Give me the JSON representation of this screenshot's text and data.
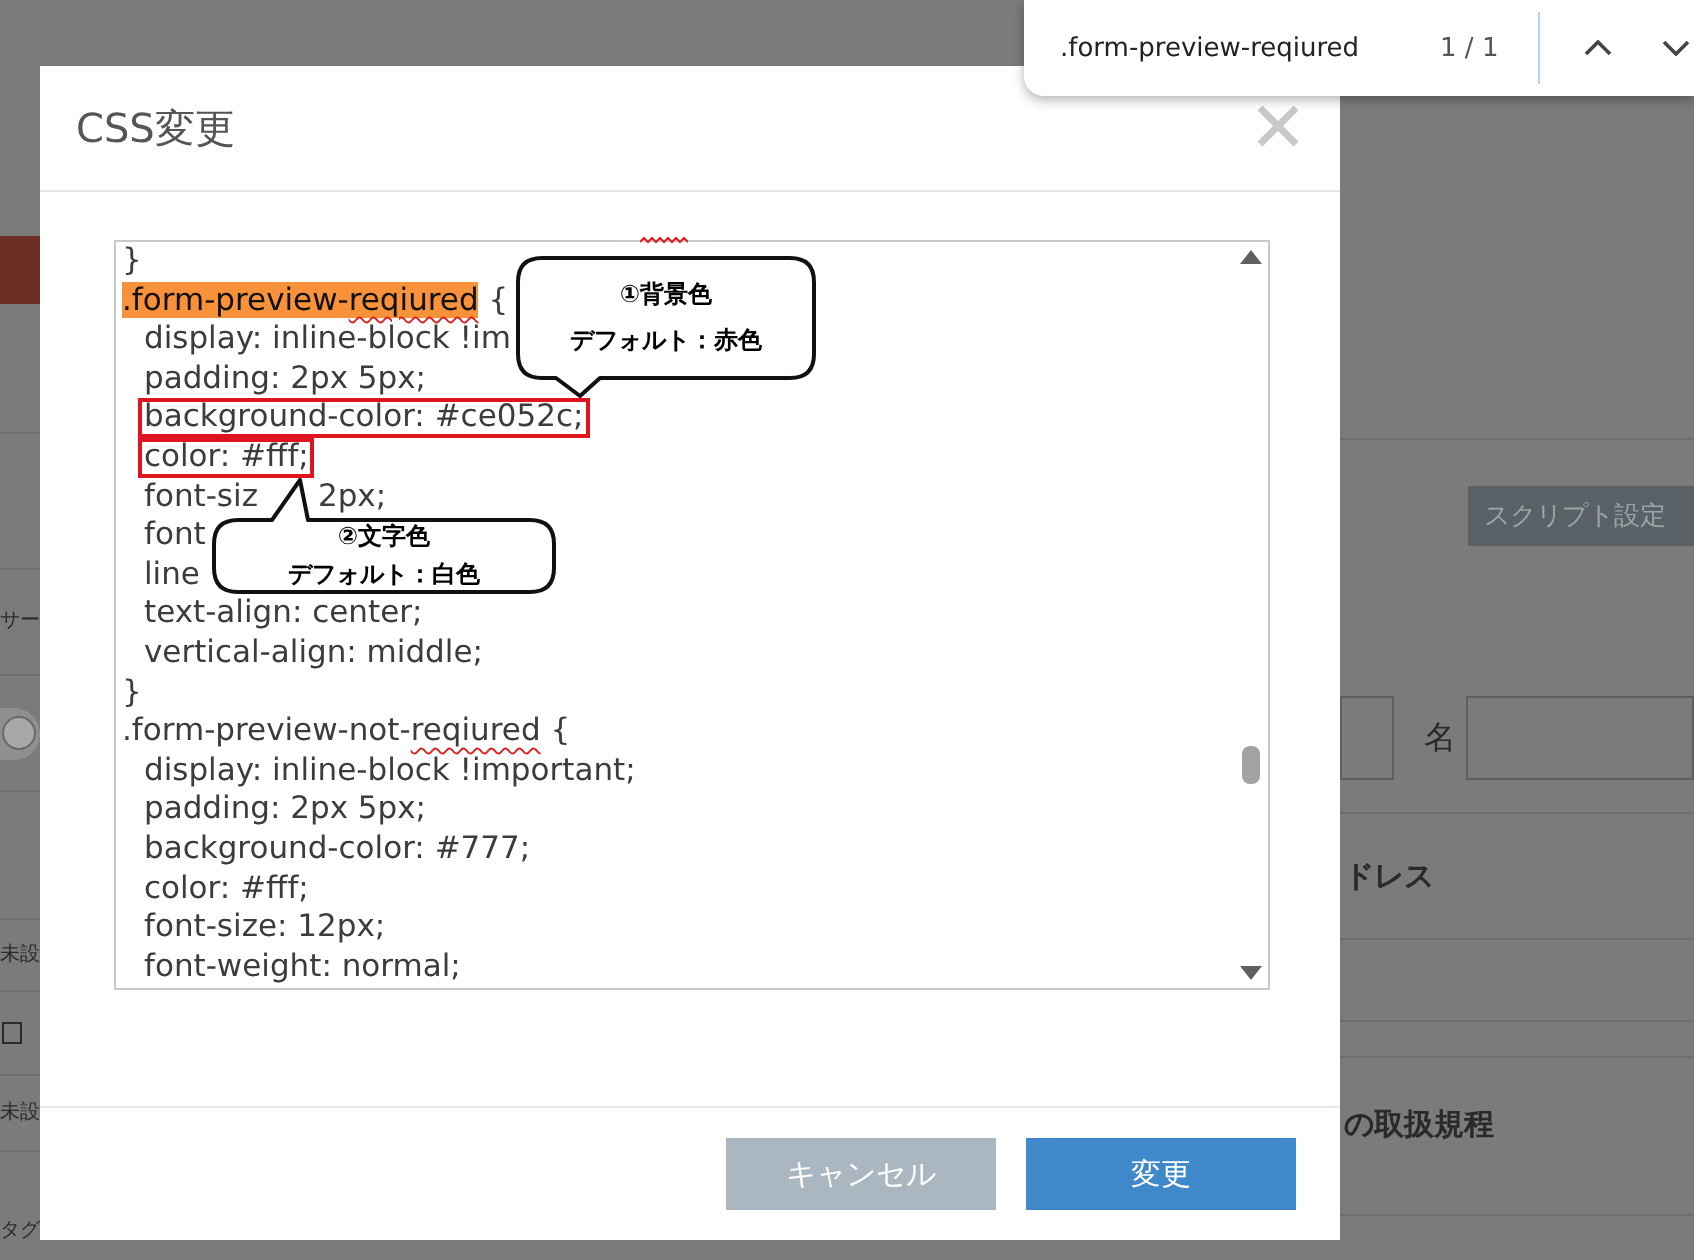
{
  "find_bar": {
    "query": ".form-preview-reqiured",
    "match_count": "1 / 1"
  },
  "dialog": {
    "title": "CSS変更",
    "editor": {
      "lines": [
        {
          "text": "}"
        },
        {
          "parts": [
            {
              "text": ".form-preview-",
              "match": true,
              "misspelled": false
            },
            {
              "text": "reqiured",
              "match": true,
              "misspelled": true
            },
            {
              "text": " {",
              "match": false,
              "misspelled": false
            }
          ],
          "children": [
            {
              "text": "display: inline-block !im",
              "framed": false
            },
            {
              "text": "padding: 2px 5px;",
              "framed": false
            },
            {
              "text": "background-color: #ce052c;",
              "framed": true
            },
            {
              "text": "color: #fff;",
              "framed": true
            },
            {
              "fragments": [
                "font-siz",
                "2px;"
              ],
              "framed": false
            },
            {
              "text": "font",
              "framed": false
            },
            {
              "text": "line",
              "framed": false
            },
            {
              "text": "text-align: center;",
              "framed": false
            },
            {
              "text": "vertical-align: middle;",
              "framed": false
            }
          ]
        },
        {
          "text": "}"
        },
        {
          "parts": [
            {
              "text": ".form-preview-not-",
              "match": false,
              "misspelled": false
            },
            {
              "text": "reqiured",
              "match": false,
              "misspelled": true
            },
            {
              "text": " {",
              "match": false,
              "misspelled": false
            }
          ],
          "children": [
            {
              "text": "display: inline-block !important;",
              "framed": false
            },
            {
              "text": "padding: 2px 5px;",
              "framed": false
            },
            {
              "text": "background-color: #777;",
              "framed": false
            },
            {
              "text": "color: #fff;",
              "framed": false
            },
            {
              "text": "font-size: 12px;",
              "framed": false
            },
            {
              "text": "font-weight: normal;",
              "framed": false
            }
          ]
        }
      ]
    },
    "callouts": [
      {
        "title": "①背景色",
        "text": "デフォルト：赤色"
      },
      {
        "title": "②文字色",
        "text": "デフォルト：白色"
      }
    ],
    "buttons": [
      {
        "label": "キャンセル",
        "kind": "cancel"
      },
      {
        "label": "変更",
        "kind": "primary"
      }
    ]
  },
  "left_panel": {
    "items": [
      {
        "kind": "bar"
      },
      {
        "kind": "label",
        "text": "サー"
      },
      {
        "kind": "switch",
        "on": false
      },
      {
        "kind": "label",
        "text": "未設"
      },
      {
        "kind": "checkbox",
        "checked": false
      },
      {
        "kind": "label",
        "text": "未設"
      },
      {
        "kind": "label",
        "text": "タグ"
      }
    ]
  },
  "right_panel": {
    "button": "スクリプト設定",
    "name_label": "名",
    "headings": [
      "ドレス",
      "の取扱規程"
    ]
  }
}
